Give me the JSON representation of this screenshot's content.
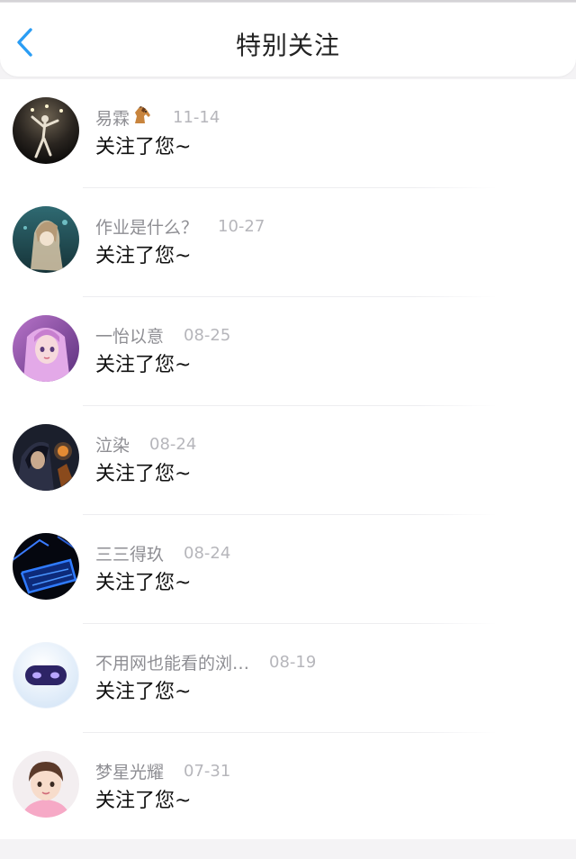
{
  "header": {
    "title": "特别关注",
    "back_icon": "chevron-left-icon",
    "accent_color": "#2a9df4"
  },
  "items": [
    {
      "name": "易霖",
      "name_emoji": "horse-icon",
      "date": "11-14",
      "message": "关注了您~",
      "avatar": "avatar-dancer-silhouette"
    },
    {
      "name": "作业是什么？",
      "date": "10-27",
      "message": "关注了您~",
      "avatar": "avatar-anime-teal"
    },
    {
      "name": "一怡以意",
      "date": "08-25",
      "message": "关注了您~",
      "avatar": "avatar-anime-purple-girl"
    },
    {
      "name": "泣染",
      "date": "08-24",
      "message": "关注了您~",
      "avatar": "avatar-dark-anime"
    },
    {
      "name": "三三得玖",
      "date": "08-24",
      "message": "关注了您~",
      "avatar": "avatar-blue-neon"
    },
    {
      "name": "不用网也能看的浏…",
      "date": "08-19",
      "message": "关注了您~",
      "avatar": "avatar-robot"
    },
    {
      "name": "梦星光耀",
      "date": "07-31",
      "message": "关注了您~",
      "avatar": "avatar-cartoon-girl"
    }
  ]
}
